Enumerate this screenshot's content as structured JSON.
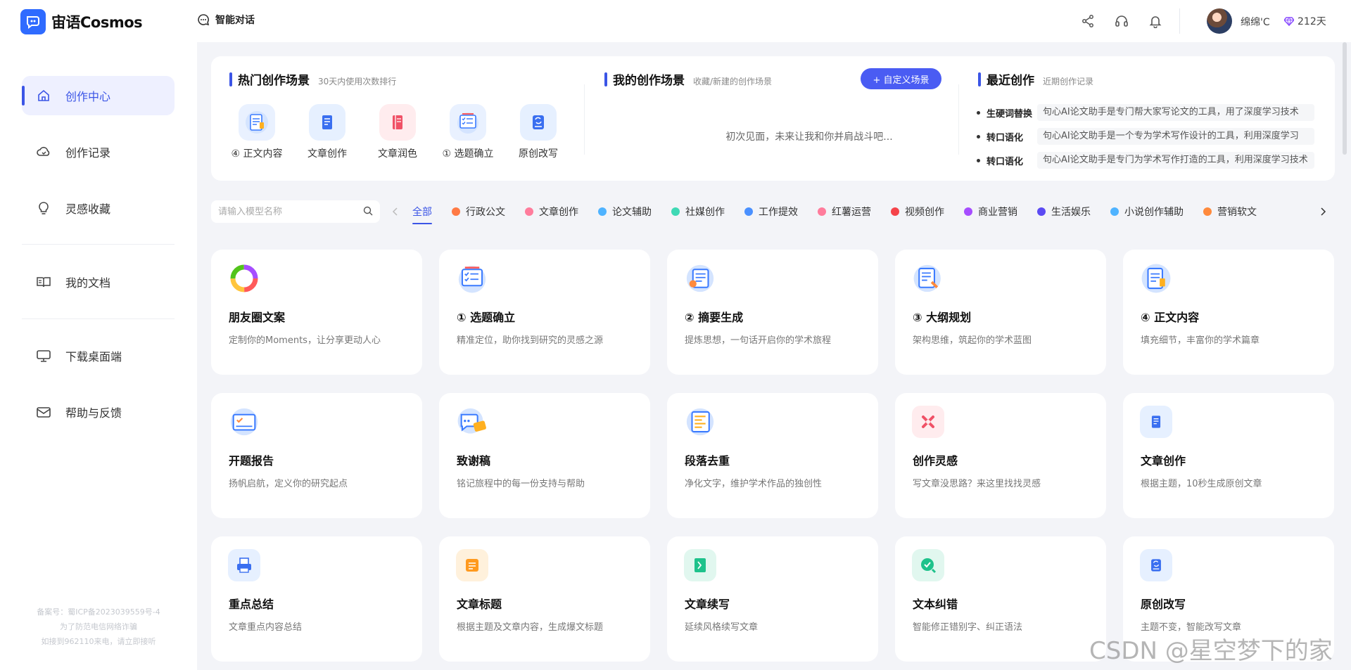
{
  "header": {
    "brand": "宙语Cosmos",
    "smart_chat": "智能对话",
    "username": "绵绵'C",
    "vip_days": "212天"
  },
  "sidebar": {
    "items": [
      {
        "label": "创作中心",
        "icon": "home-icon",
        "active": true
      },
      {
        "label": "创作记录",
        "icon": "cloud-icon"
      },
      {
        "label": "灵感收藏",
        "icon": "bulb-icon"
      },
      {
        "label": "我的文档",
        "icon": "book-icon"
      },
      {
        "label": "下载桌面端",
        "icon": "monitor-icon"
      },
      {
        "label": "帮助与反馈",
        "icon": "mail-icon"
      }
    ],
    "footer": [
      "备案号：蜀ICP备2023039559号-4",
      "为了防范电信网络诈骗",
      "如接到962110来电，请立即接听"
    ]
  },
  "hot_scenes": {
    "title": "热门创作场景",
    "subtitle": "30天内使用次数排行",
    "items": [
      {
        "label": "④ 正文内容",
        "icon": "clipboard-icon",
        "bg": "#e9f1ff"
      },
      {
        "label": "文章创作",
        "icon": "document-icon",
        "bg": "#e6f0ff"
      },
      {
        "label": "文章润色",
        "icon": "notebook-icon",
        "bg": "#ffecee"
      },
      {
        "label": "① 选题确立",
        "icon": "checklist-icon",
        "bg": "#e9f1ff"
      },
      {
        "label": "原创改写",
        "icon": "rewrite-icon",
        "bg": "#e6f0ff"
      }
    ]
  },
  "my_scenes": {
    "title": "我的创作场景",
    "subtitle": "收藏/新建的创作场景",
    "button": "+ 自定义场景",
    "empty": "初次见面，未来让我和你并肩战斗吧..."
  },
  "recent": {
    "title": "最近创作",
    "subtitle": "近期创作记录",
    "items": [
      {
        "key": "生硬词替换",
        "value": "句心AI论文助手是专门帮大家写论文的工具，用了深度学习技术"
      },
      {
        "key": "转口语化",
        "value": "句心AI论文助手是一个专为学术写作设计的工具，利用深度学习"
      },
      {
        "key": "转口语化",
        "value": "句心AI论文助手是专门为学术写作打造的工具，利用深度学习技术"
      }
    ]
  },
  "search": {
    "placeholder": "请输入模型名称"
  },
  "categories": [
    {
      "label": "全部",
      "active": true
    },
    {
      "label": "行政公文",
      "color": "#ff7a45"
    },
    {
      "label": "文章创作",
      "color": "#ff7c9c"
    },
    {
      "label": "论文辅助",
      "color": "#4fb3ff"
    },
    {
      "label": "社媒创作",
      "color": "#3fd9b5"
    },
    {
      "label": "工作提效",
      "color": "#4a90ff"
    },
    {
      "label": "红薯运营",
      "color": "#ff7c9c"
    },
    {
      "label": "视频创作",
      "color": "#f5434a"
    },
    {
      "label": "商业营销",
      "color": "#a64dff"
    },
    {
      "label": "生活娱乐",
      "color": "#5b4af3"
    },
    {
      "label": "小说创作辅助",
      "color": "#4fb3ff"
    },
    {
      "label": "营销软文",
      "color": "#ff8a3d"
    }
  ],
  "cards": [
    {
      "title": "朋友圈文案",
      "desc": "定制你的Moments，让分享更动人心",
      "icon": "ring-icon",
      "bg": "#ffffff"
    },
    {
      "title": "① 选题确立",
      "desc": "精准定位，助你找到研究的灵感之源",
      "icon": "checklist-icon",
      "bg": "#e9f1ff"
    },
    {
      "title": "② 摘要生成",
      "desc": "提炼思想，一句话开启你的学术旅程",
      "icon": "summary-icon",
      "bg": "#e9f1ff"
    },
    {
      "title": "③ 大纲规划",
      "desc": "架构思维，筑起你的学术蓝图",
      "icon": "outline-icon",
      "bg": "#e9f1ff"
    },
    {
      "title": "④ 正文内容",
      "desc": "填充细节，丰富你的学术篇章",
      "icon": "clipboard-icon",
      "bg": "#e9f1ff"
    },
    {
      "title": "开题报告",
      "desc": "扬帆启航，定义你的研究起点",
      "icon": "report-icon",
      "bg": "#e9f1ff"
    },
    {
      "title": "致谢稿",
      "desc": "铭记旅程中的每一份支持与帮助",
      "icon": "chat-bubble-icon",
      "bg": "#e9f1ff"
    },
    {
      "title": "段落去重",
      "desc": "净化文字，维护学术作品的独创性",
      "icon": "dedupe-icon",
      "bg": "#e9f1ff"
    },
    {
      "title": "创作灵感",
      "desc": "写文章没思路？来这里找找灵感",
      "icon": "spark-icon",
      "bg": "#ffecee"
    },
    {
      "title": "文章创作",
      "desc": "根据主题，10秒生成原创文章",
      "icon": "document-icon",
      "bg": "#e6f0ff"
    },
    {
      "title": "重点总结",
      "desc": "文章重点内容总结",
      "icon": "printer-icon",
      "bg": "#e6f0ff"
    },
    {
      "title": "文章标题",
      "desc": "根据主题及文章内容，生成爆文标题",
      "icon": "title-icon",
      "bg": "#fff1dc"
    },
    {
      "title": "文章续写",
      "desc": "延续风格续写文章",
      "icon": "continue-icon",
      "bg": "#e1f7ef"
    },
    {
      "title": "文本纠错",
      "desc": "智能修正错别字、纠正语法",
      "icon": "check-search-icon",
      "bg": "#e1f7ef"
    },
    {
      "title": "原创改写",
      "desc": "主题不变，智能改写文章",
      "icon": "rewrite-icon",
      "bg": "#e6f0ff"
    }
  ],
  "watermark": "CSDN @星空梦下的家",
  "colors": {
    "accent": "#3b55e6",
    "button": "#4a5cf3",
    "brand": "#2f6bff"
  }
}
